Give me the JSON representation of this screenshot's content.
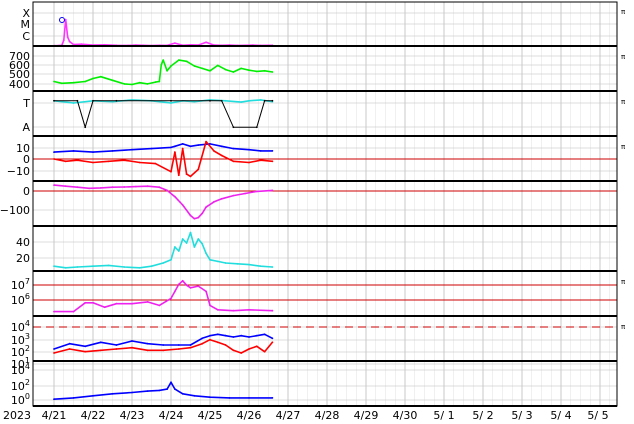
{
  "colors": {
    "xray": "#ff33ff",
    "protons": "#00ee00",
    "bz": "#ff0000",
    "bt": "#0000ff",
    "dst": "#ee22ee",
    "speed": "#22dddd",
    "thick_line": "#000000",
    "red_ref": "#cc0000",
    "grid": "#bdbdbd"
  },
  "chart_data": {
    "type": "line",
    "x_tick_labels": [
      "2023",
      "4/21",
      "4/22",
      "4/23",
      "4/24",
      "4/25",
      "4/26",
      "4/27",
      "4/28",
      "4/29",
      "4/30",
      "5/ 1",
      "5/ 2",
      "5/ 3",
      "5/ 4",
      "5/ 5"
    ],
    "right_marker": "π",
    "panels": [
      {
        "id": "xray",
        "y_tick_labels": [
          "X",
          "M",
          "C"
        ],
        "series": [
          {
            "color_key": "xray",
            "x": [
              0,
              0.1,
              0.2,
              0.25,
              0.3,
              0.35,
              0.4,
              0.5,
              0.7,
              1.0,
              1.3,
              1.6,
              1.9,
              2.1,
              2.3,
              2.5,
              2.7,
              2.9,
              3.1,
              3.3,
              3.5,
              3.7,
              3.9,
              4.1,
              4.3,
              4.5,
              4.7,
              4.9,
              5.1,
              5.3,
              5.5,
              5.6
            ],
            "y": [
              0.02,
              0.03,
              0.05,
              0.4,
              1.8,
              0.6,
              0.3,
              0.1,
              0.12,
              0.06,
              0.08,
              0.05,
              0.04,
              0.06,
              0.05,
              0.03,
              0.05,
              0.04,
              0.2,
              0.05,
              0.08,
              0.06,
              0.25,
              0.06,
              0.05,
              0.07,
              0.04,
              0.05,
              0.06,
              0.04,
              0.05,
              0.05
            ]
          }
        ]
      },
      {
        "id": "protons",
        "y_tick_labels": [
          "700",
          "600",
          "500",
          "400"
        ],
        "series": [
          {
            "color_key": "protons",
            "x": [
              0,
              0.2,
              0.5,
              0.8,
              1.0,
              1.2,
              1.5,
              1.8,
              2.0,
              2.2,
              2.4,
              2.6,
              2.7,
              2.75,
              2.8,
              2.9,
              3.0,
              3.2,
              3.4,
              3.6,
              3.8,
              4.0,
              4.2,
              4.4,
              4.6,
              4.8,
              5.0,
              5.2,
              5.4,
              5.6
            ],
            "y": [
              430,
              415,
              420,
              430,
              455,
              470,
              440,
              410,
              405,
              420,
              410,
              425,
              430,
              570,
              610,
              520,
              560,
              610,
              600,
              560,
              540,
              520,
              565,
              530,
              510,
              540,
              525,
              515,
              520,
              510
            ]
          }
        ]
      },
      {
        "id": "imf-phi",
        "y_tick_labels": [
          "T",
          "A"
        ],
        "series": [
          {
            "color_key": "speed",
            "x": [
              0,
              0.5,
              1.0,
              1.5,
              2.0,
              2.5,
              3.0,
              3.3,
              3.6,
              4.0,
              4.4,
              4.8,
              5.0,
              5.3,
              5.6
            ],
            "y": [
              0.8,
              0.75,
              0.8,
              0.78,
              0.82,
              0.8,
              0.75,
              0.8,
              0.78,
              0.82,
              0.8,
              0.77,
              0.8,
              0.82,
              0.78
            ]
          },
          {
            "color_key": "thick_line",
            "x": [
              0,
              0.6,
              0.8,
              1.0,
              1.6,
              3.0,
              4.0,
              4.3,
              4.6,
              5.2,
              5.4,
              5.6
            ],
            "y": [
              0.8,
              0.8,
              0.2,
              0.8,
              0.8,
              0.8,
              0.8,
              0.8,
              0.2,
              0.2,
              0.8,
              0.8
            ]
          }
        ]
      },
      {
        "id": "imf-bz",
        "y_tick_labels": [
          "10",
          "0",
          "−10"
        ],
        "series": [
          {
            "color_key": "bt",
            "x": [
              0,
              0.5,
              1.0,
              1.5,
              2.0,
              2.5,
              3.0,
              3.1,
              3.3,
              3.5,
              3.7,
              4.0,
              4.3,
              4.6,
              5.0,
              5.3,
              5.6
            ],
            "y": [
              5,
              6,
              5,
              6,
              7,
              8,
              9,
              10,
              12,
              10,
              11,
              12,
              10,
              8,
              7,
              6,
              6
            ]
          },
          {
            "color_key": "bz",
            "x": [
              0,
              0.3,
              0.6,
              1.0,
              1.4,
              1.8,
              2.2,
              2.6,
              3.0,
              3.1,
              3.2,
              3.3,
              3.4,
              3.5,
              3.7,
              3.9,
              4.1,
              4.3,
              4.6,
              5.0,
              5.3,
              5.6
            ],
            "y": [
              -1,
              -3,
              -2,
              -4,
              -3,
              -2,
              -4,
              -5,
              -12,
              5,
              -15,
              8,
              -14,
              -16,
              -10,
              14,
              6,
              2,
              -3,
              -4,
              -2,
              -3
            ]
          }
        ]
      },
      {
        "id": "dst",
        "y_tick_labels": [
          "0",
          "−100"
        ],
        "series": [
          {
            "color_key": "dst",
            "x": [
              0,
              0.3,
              0.6,
              0.9,
              1.2,
              1.5,
              1.8,
              2.1,
              2.4,
              2.7,
              2.9,
              3.1,
              3.3,
              3.5,
              3.6,
              3.7,
              3.8,
              3.9,
              4.1,
              4.3,
              4.6,
              4.9,
              5.2,
              5.6
            ],
            "y": [
              -5,
              -10,
              -15,
              -20,
              -18,
              -15,
              -14,
              -12,
              -10,
              -15,
              -30,
              -60,
              -100,
              -150,
              -165,
              -160,
              -140,
              -110,
              -85,
              -70,
              -55,
              -45,
              -35,
              -30
            ]
          }
        ]
      },
      {
        "id": "speed",
        "y_tick_labels": [
          "40",
          "20"
        ],
        "series": [
          {
            "color_key": "speed",
            "x": [
              0,
              0.3,
              0.6,
              1.0,
              1.4,
              1.8,
              2.2,
              2.5,
              2.8,
              3.0,
              3.1,
              3.2,
              3.3,
              3.4,
              3.5,
              3.6,
              3.7,
              3.8,
              3.9,
              4.0,
              4.2,
              4.4,
              4.7,
              5.0,
              5.3,
              5.6
            ],
            "y": [
              6,
              4,
              5,
              6,
              7,
              5,
              4,
              6,
              10,
              14,
              30,
              25,
              40,
              35,
              48,
              30,
              40,
              34,
              22,
              14,
              12,
              10,
              9,
              8,
              6,
              5
            ]
          }
        ]
      },
      {
        "id": "electrons",
        "y_tick_labels": [
          "10^7",
          "10^6"
        ],
        "series": [
          {
            "color_key": "dst",
            "x": [
              0,
              0.5,
              0.8,
              1.0,
              1.3,
              1.6,
              2.0,
              2.4,
              2.7,
              3.0,
              3.1,
              3.2,
              3.3,
              3.4,
              3.5,
              3.7,
              3.9,
              4.0,
              4.2,
              4.6,
              5.0,
              5.6
            ],
            "y": [
              3.5,
              3.5,
              4.5,
              4.5,
              4.0,
              4.4,
              4.4,
              4.6,
              4.2,
              5.0,
              5.8,
              6.6,
              7.0,
              6.5,
              6.2,
              6.4,
              5.8,
              4.2,
              3.7,
              3.6,
              3.7,
              3.6
            ]
          }
        ]
      },
      {
        "id": "eflux",
        "y_tick_labels": [
          "10^4",
          "10^3",
          "10^2",
          "10^1"
        ],
        "series": [
          {
            "color_key": "bt",
            "x": [
              0,
              0.4,
              0.8,
              1.2,
              1.6,
              2.0,
              2.4,
              2.8,
              3.2,
              3.5,
              3.8,
              4.0,
              4.2,
              4.4,
              4.6,
              4.8,
              5.0,
              5.2,
              5.4,
              5.6
            ],
            "y": [
              1.9,
              2.3,
              2.1,
              2.4,
              2.2,
              2.5,
              2.3,
              2.2,
              2.2,
              2.2,
              2.7,
              2.9,
              3.0,
              2.9,
              2.8,
              2.9,
              2.8,
              2.9,
              3.0,
              2.7
            ]
          },
          {
            "color_key": "bz",
            "x": [
              0,
              0.4,
              0.8,
              1.2,
              1.6,
              2.0,
              2.4,
              2.8,
              3.2,
              3.5,
              3.8,
              4.0,
              4.2,
              4.4,
              4.6,
              4.8,
              5.0,
              5.2,
              5.4,
              5.6
            ],
            "y": [
              1.6,
              1.9,
              1.7,
              1.8,
              1.9,
              2.0,
              1.8,
              1.8,
              1.9,
              2.0,
              2.3,
              2.6,
              2.4,
              2.2,
              1.8,
              1.6,
              1.9,
              2.1,
              1.7,
              2.4
            ]
          }
        ]
      },
      {
        "id": "proton-flux",
        "y_tick_labels": [
          "10^4",
          "10^2",
          "10^0"
        ],
        "series": [
          {
            "color_key": "bt",
            "x": [
              0,
              0.5,
              1.0,
              1.5,
              2.0,
              2.4,
              2.7,
              2.9,
              3.0,
              3.1,
              3.3,
              3.6,
              4.0,
              4.5,
              5.0,
              5.6
            ],
            "y": [
              -0.5,
              -0.3,
              0.0,
              0.3,
              0.5,
              0.7,
              0.8,
              1.0,
              2.0,
              1.0,
              0.3,
              0.0,
              -0.2,
              -0.3,
              -0.3,
              -0.3
            ]
          }
        ]
      }
    ]
  }
}
